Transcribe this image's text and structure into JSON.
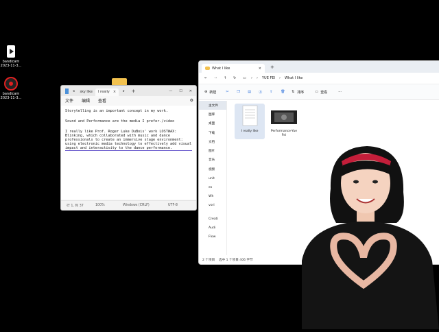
{
  "desktop": {
    "icons": [
      {
        "label": "bandicam",
        "sub": "2023-11-3..."
      },
      {
        "label": "bandicam",
        "sub": "2023-11-3..."
      }
    ]
  },
  "notepad": {
    "tabs": [
      "sky like",
      "I really"
    ],
    "menu": [
      "文件",
      "编辑",
      "查看"
    ],
    "paragraphs": [
      "Storytelling is an important concept in my work.",
      "Sound and Performance are the media I prefer./video",
      "I really like Prof. Roger Luke DuBois' work LOSTWAX: Blinking, which collaborated with music and dance professionals to create an immersive stage environment: using electronic media technology to effectively add visual impact and interactivity to the dance performance."
    ],
    "status": {
      "position": "行 1, 列 37",
      "zoom": "100%",
      "eol": "Windows (CRLF)",
      "encoding": "UTF-8"
    }
  },
  "explorer": {
    "tab_title": "What I like",
    "breadcrumb": [
      "YUE FEI",
      "What I like"
    ],
    "commands": {
      "new": "新建",
      "sort": "排序",
      "view": "查看"
    },
    "sidebar": [
      "主文件",
      "图库",
      "桌面",
      "下载",
      "文档",
      "图片",
      "音乐",
      "视频",
      "unit",
      "es",
      "Wh",
      "vori",
      "Creati",
      "Audi",
      "Flow"
    ],
    "files": [
      {
        "name": "I really like",
        "type": "document"
      },
      {
        "name": "Performance-Yue Fei",
        "type": "video"
      }
    ],
    "status": {
      "count": "2 个项目",
      "selected": "选中 1 个项目  406 字节"
    }
  },
  "colors": {
    "taskbar_black": "#000000",
    "accent": "#0067c0",
    "folder_yellow": "#f2c14e"
  }
}
